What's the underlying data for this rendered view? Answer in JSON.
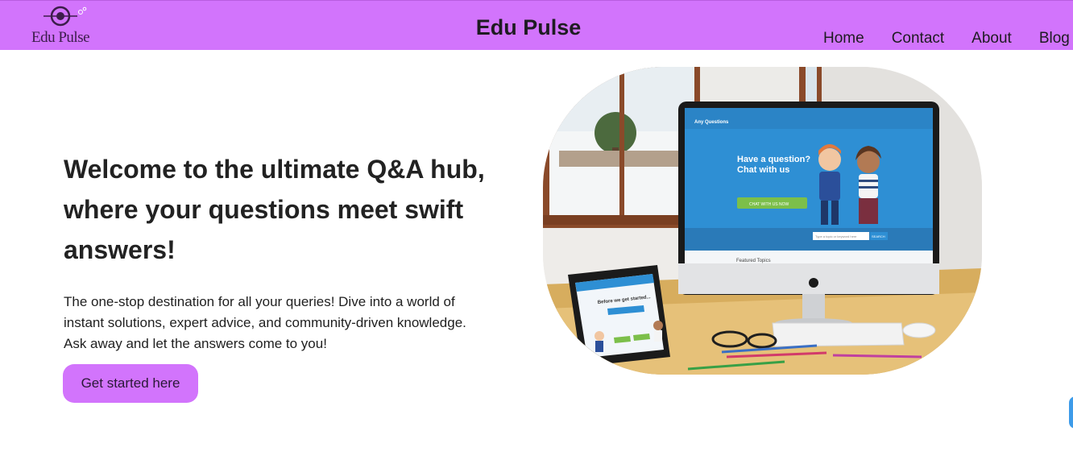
{
  "header": {
    "logo_icon": "eye-logo-icon",
    "logo_text": "Edu Pulse",
    "title": "Edu Pulse",
    "nav": [
      {
        "label": "Home"
      },
      {
        "label": "Contact"
      },
      {
        "label": "About"
      },
      {
        "label": "Blog"
      }
    ]
  },
  "hero": {
    "heading": "Welcome to the ultimate Q&A hub, where your questions meet swift answers!",
    "paragraph": "The one-stop destination for all your queries! Dive into a world of instant solutions, expert advice, and community-driven knowledge. Ask away and let the answers come to you!",
    "cta_label": "Get started here",
    "image": {
      "monitor_screen": {
        "brand": "Any Questions",
        "headline_line1": "Have a question?",
        "headline_line2": "Chat with us",
        "button": "CHAT WITH US NOW",
        "search_placeholder": "Type a topic or keyword here",
        "search_button": "SEARCH",
        "featured": "Featured Topics"
      },
      "tablet_screen": {
        "title": "Before we get started..."
      }
    }
  },
  "chat_widget": {
    "icon": "chat-bubble-icon"
  },
  "colors": {
    "accent": "#d274fc",
    "text": "#1f1f1f",
    "screen_blue": "#2e8fd4"
  }
}
